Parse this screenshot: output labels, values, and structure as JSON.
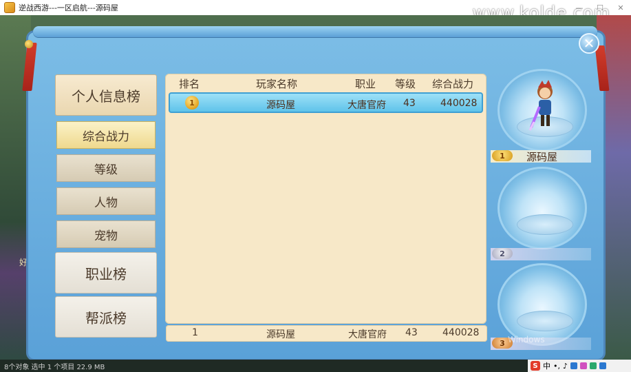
{
  "window": {
    "title": "逆战西游---一区启航---源码屋",
    "watermark": "www.kolde.com"
  },
  "status_bar": {
    "text": "8个对象    选中 1 个项目 22.9 MB"
  },
  "side_text": "好友",
  "categories": {
    "personal_title": "个人信息榜",
    "personal_items": [
      "综合战力",
      "等级",
      "人物",
      "宠物"
    ],
    "active_index": 0,
    "career_title": "职业榜",
    "guild_title": "帮派榜"
  },
  "table": {
    "headers": {
      "rank": "排名",
      "player": "玩家名称",
      "career": "职业",
      "level": "等级",
      "power": "综合战力"
    },
    "rows": [
      {
        "rank": 1,
        "player": "源码屋",
        "career": "大唐官府",
        "level": "43",
        "power": "440028"
      }
    ],
    "my_row": {
      "rank": "1",
      "player": "源码屋",
      "career": "大唐官府",
      "level": "43",
      "power": "440028"
    }
  },
  "podium": [
    {
      "rank": "1",
      "name": "源码屋"
    },
    {
      "rank": "2",
      "name": ""
    },
    {
      "rank": "3",
      "name": ""
    }
  ],
  "activation_watermark": "Windows",
  "icons": {
    "close": "close-icon",
    "medal": "gold-medal-icon"
  },
  "colors": {
    "panel": "#6aaee0",
    "selected_row": "#7fd2f2",
    "active_tab": "#efd98e"
  }
}
